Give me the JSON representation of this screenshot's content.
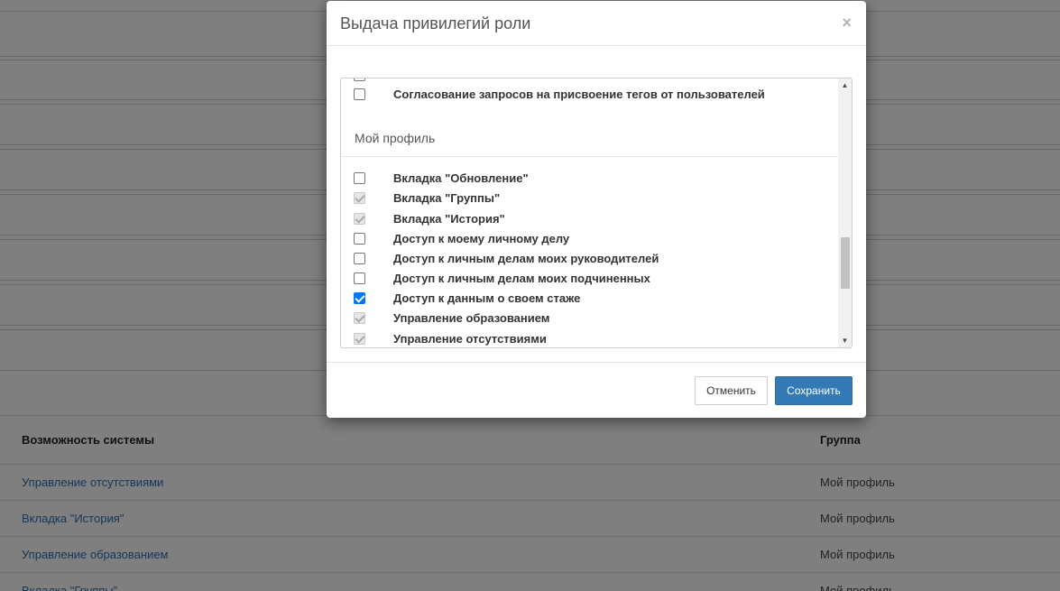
{
  "modal": {
    "title": "Выдача привилегий роли",
    "close_label": "×",
    "top_item_label": "Согласование запросов на присвоение тегов от пользователей",
    "section_title": "Мой профиль",
    "items": [
      {
        "label": "Вкладка \"Обновление\"",
        "state": "unchecked"
      },
      {
        "label": "Вкладка \"Группы\"",
        "state": "checked-disabled"
      },
      {
        "label": "Вкладка \"История\"",
        "state": "checked-disabled"
      },
      {
        "label": "Доступ к моему личному делу",
        "state": "unchecked"
      },
      {
        "label": "Доступ к личным делам моих руководителей",
        "state": "unchecked"
      },
      {
        "label": "Доступ к личным делам моих подчиненных",
        "state": "unchecked"
      },
      {
        "label": "Доступ к данным о своем стаже",
        "state": "checked"
      },
      {
        "label": "Управление образованием",
        "state": "checked-disabled"
      },
      {
        "label": "Управление отсутствиями",
        "state": "checked-disabled"
      }
    ],
    "cancel_label": "Отменить",
    "save_label": "Сохранить"
  },
  "table": {
    "headers": [
      "Возможность системы",
      "Группа"
    ],
    "rows": [
      [
        "Управление отсутствиями",
        "Мой профиль"
      ],
      [
        "Вкладка \"История\"",
        "Мой профиль"
      ],
      [
        "Управление образованием",
        "Мой профиль"
      ],
      [
        "Вкладка \"Группы\"",
        "Мой профиль"
      ]
    ]
  },
  "colors": {
    "primary": "#337ab7",
    "checkbox_checked": "#0075ff",
    "link": "#2a6fb5"
  }
}
